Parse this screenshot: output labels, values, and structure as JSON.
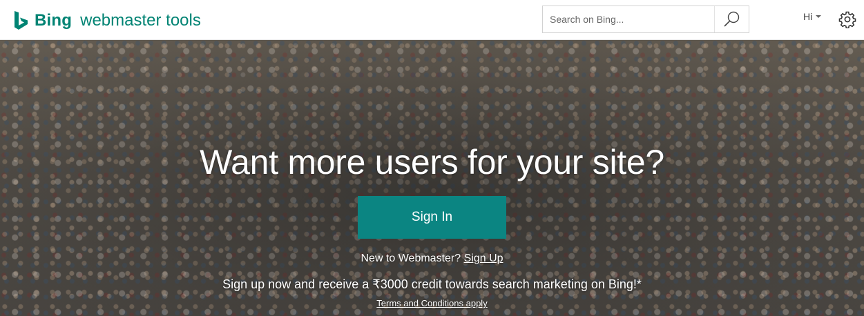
{
  "header": {
    "brand": "Bing",
    "product": "webmaster tools",
    "logo_icon": "bing-b-icon",
    "brand_color": "#008373"
  },
  "search": {
    "placeholder": "Search on Bing...",
    "value": "",
    "button_icon": "search-icon"
  },
  "user_menu": {
    "greeting": "Hi",
    "settings_icon": "gear-icon"
  },
  "hero": {
    "headline": "Want more users for your site?",
    "sign_in_label": "Sign In",
    "sign_in_color": "#0b8582",
    "new_user_text": "New to Webmaster?",
    "sign_up_label": "Sign Up",
    "promo_text": "Sign up now and receive a ₹3000 credit towards search marketing on Bing!*",
    "terms_label": "Terms and Conditions apply"
  }
}
